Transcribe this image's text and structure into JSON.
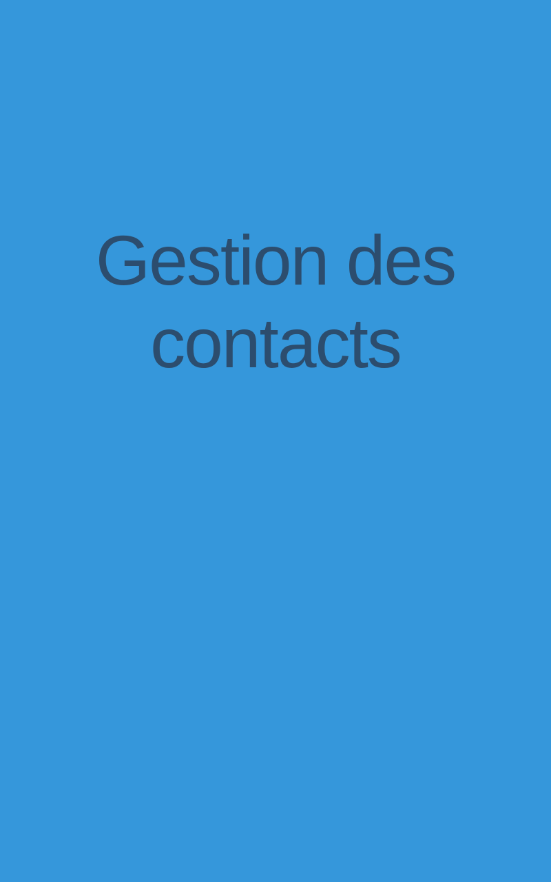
{
  "splash": {
    "background_color": "#3597db",
    "text_color": "#2c4d6e",
    "title_line_1": "Gestion des",
    "title_line_2": "contacts"
  }
}
